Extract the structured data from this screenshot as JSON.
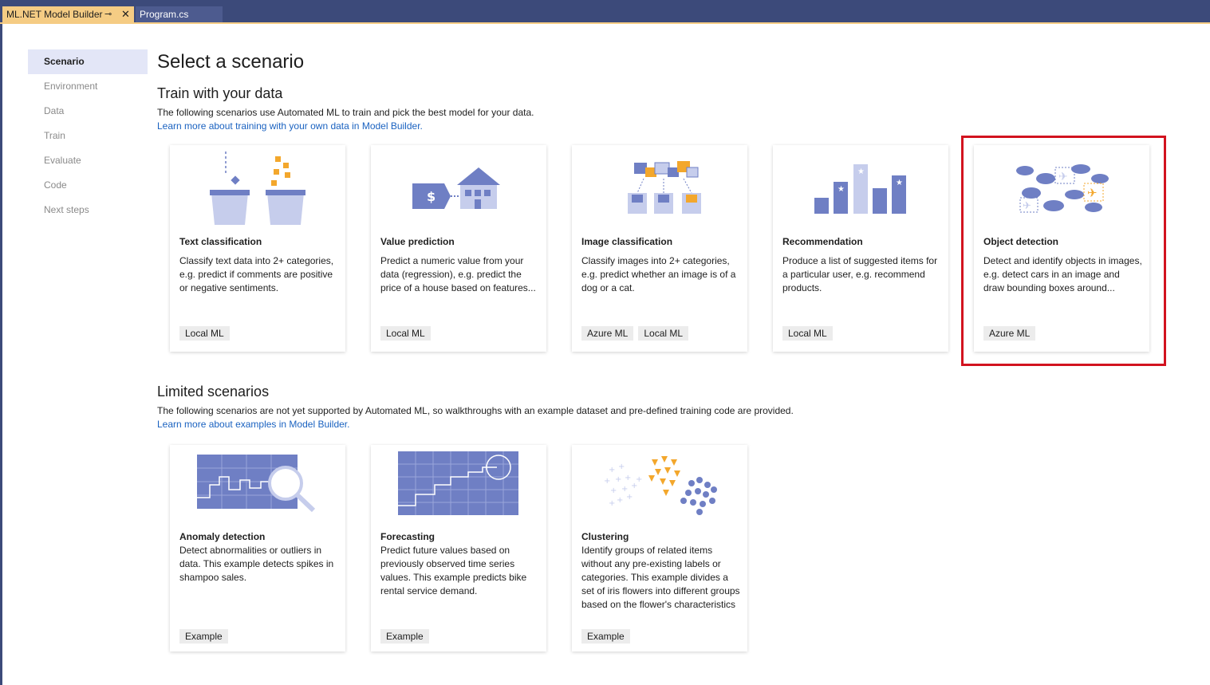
{
  "tabs": [
    {
      "label": "ML.NET Model Builder"
    },
    {
      "label": "Program.cs"
    }
  ],
  "sidebar": {
    "items": [
      {
        "label": "Scenario"
      },
      {
        "label": "Environment"
      },
      {
        "label": "Data"
      },
      {
        "label": "Train"
      },
      {
        "label": "Evaluate"
      },
      {
        "label": "Code"
      },
      {
        "label": "Next steps"
      }
    ]
  },
  "main": {
    "title": "Select a scenario",
    "train_section": {
      "title": "Train with your data",
      "description": "The following scenarios use Automated ML to train and pick the best model for your data.",
      "link": "Learn more about training with your own data in Model Builder."
    },
    "limited_section": {
      "title": "Limited scenarios",
      "description": "The following scenarios are not yet supported by Automated ML, so walkthroughs with an example dataset and pre-defined training code are provided.",
      "link": "Learn more about examples in Model Builder."
    },
    "train_cards": [
      {
        "title": "Text classification",
        "description": "Classify text data into 2+ categories, e.g. predict if comments are positive or negative sentiments.",
        "tags": [
          "Local ML"
        ]
      },
      {
        "title": "Value prediction",
        "description": "Predict a numeric value from your data (regression), e.g. predict the price of a house based on features...",
        "tags": [
          "Local ML"
        ]
      },
      {
        "title": "Image classification",
        "description": "Classify images into 2+ categories, e.g. predict whether an image is of a dog or a cat.",
        "tags": [
          "Azure ML",
          "Local ML"
        ]
      },
      {
        "title": "Recommendation",
        "description": "Produce a list of suggested items for a particular user, e.g. recommend products.",
        "tags": [
          "Local ML"
        ]
      },
      {
        "title": "Object detection",
        "description": "Detect and identify objects in images, e.g. detect cars in an image and draw bounding boxes around...",
        "tags": [
          "Azure ML"
        ]
      }
    ],
    "limited_cards": [
      {
        "title": "Anomaly detection",
        "description": "Detect abnormalities or outliers in data. This example detects spikes in shampoo sales.",
        "tags": [
          "Example"
        ]
      },
      {
        "title": "Forecasting",
        "description": "Predict future values based on previously observed time series values. This example predicts bike rental service demand.",
        "tags": [
          "Example"
        ]
      },
      {
        "title": "Clustering",
        "description": "Identify groups of related items without any pre-existing labels or categories. This example divides a set of iris flowers into different groups based on the flower's characteristics",
        "tags": [
          "Example"
        ]
      }
    ]
  },
  "colors": {
    "accent": "#1a62c0",
    "highlight": "#d2131f",
    "illustration_primary": "#6f7fc4",
    "illustration_secondary": "#f3a72c"
  }
}
